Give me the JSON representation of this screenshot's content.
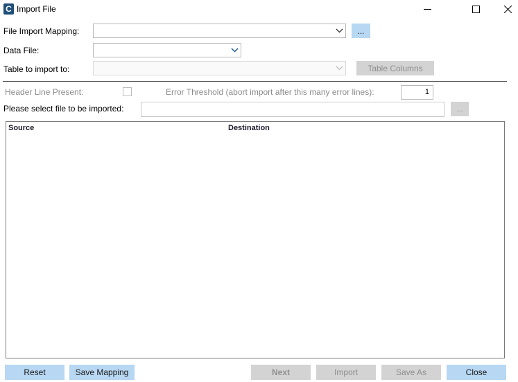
{
  "window": {
    "title": "Import File",
    "app_icon_letter": "C"
  },
  "form": {
    "mapping_label": "File Import Mapping:",
    "mapping_value": "",
    "browse_mapping_label": "...",
    "data_file_label": "Data File:",
    "data_file_value": "",
    "table_label": "Table to import to:",
    "table_value": "",
    "table_columns_label": "Table Columns",
    "header_line_label": "Header Line Present:",
    "header_line_checked": false,
    "error_threshold_label": "Error Threshold (abort import after this many error lines):",
    "error_threshold_value": "1",
    "select_file_label": "Please select file to be imported:",
    "select_file_value": "",
    "browse_file_label": "..."
  },
  "grid": {
    "columns": [
      "Source",
      "Destination"
    ],
    "rows": []
  },
  "footer": {
    "reset_label": "Reset",
    "save_mapping_label": "Save Mapping",
    "next_label": "Next",
    "import_label": "Import",
    "save_as_label": "Save As",
    "close_label": "Close"
  },
  "colors": {
    "accent_button": "#b7d7f2",
    "disabled_button": "#d3d3d3",
    "dropdown_arrow": "#1f5c8a",
    "app_icon": "#1f4e79"
  },
  "icons": {
    "app": "app-logo-icon",
    "minimize": "minimize-icon",
    "maximize": "maximize-icon",
    "close": "close-icon",
    "dropdown": "chevron-down-icon"
  }
}
